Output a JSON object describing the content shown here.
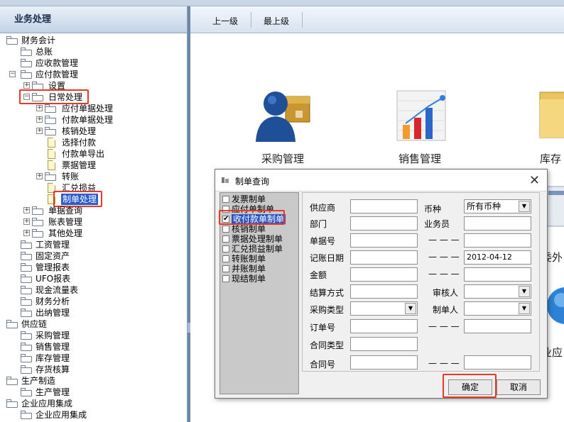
{
  "left_panel": {
    "title": "业务处理"
  },
  "tree": {
    "n0": "财务会计",
    "n1": "总账",
    "n2": "应收款管理",
    "n3": "应付款管理",
    "n4": "设置",
    "n5": "日常处理",
    "n6": "应付单据处理",
    "n7": "付款单据处理",
    "n8": "核销处理",
    "n9": "选择付款",
    "n10": "付款单导出",
    "n11": "票据管理",
    "n12": "转账",
    "n13": "汇兑损益",
    "n14": "制单处理",
    "n15": "单据查询",
    "n16": "账表管理",
    "n17": "其他处理",
    "n18": "工资管理",
    "n19": "固定资产",
    "n20": "管理报表",
    "n21": "UFO报表",
    "n22": "现金流量表",
    "n23": "财务分析",
    "n24": "出纳管理",
    "n25": "供应链",
    "n26": "采购管理",
    "n27": "销售管理",
    "n28": "库存管理",
    "n29": "存货核算",
    "n30": "生产制造",
    "n31": "生产管理",
    "n32": "企业应用集成",
    "n33": "企业应用集成"
  },
  "toolbar": {
    "up_level": "上一级",
    "top_level": "最上级"
  },
  "modules": {
    "purchase": "采购管理",
    "sales": "销售管理",
    "inventory": "库存",
    "outsource": "委外",
    "enterprise": "业应"
  },
  "dialog": {
    "title": "制单查询",
    "types": [
      "发票制单",
      "应付单制单",
      "收付款单制单",
      "核销制单",
      "票据处理制单",
      "汇兑损益制单",
      "转账制单",
      "并账制单",
      "现结制单"
    ],
    "checked_index": 2,
    "labels": {
      "supplier": "供应商",
      "currency": "币种",
      "department": "部门",
      "salesperson": "业务员",
      "doc_no": "单据号",
      "dash": "— — —",
      "post_date": "记账日期",
      "amount": "金额",
      "settle_method": "结算方式",
      "auditor": "审核人",
      "purchase_type": "采购类型",
      "maker": "制单人",
      "order_no": "订单号",
      "contract_type": "合同类型",
      "contract_no": "合同号"
    },
    "values": {
      "currency": "所有币种",
      "post_date_to": "2012-04-12"
    },
    "ok": "确定",
    "cancel": "取消"
  },
  "colors": {
    "highlight": "#e53a2a",
    "selection": "#2b56c2"
  }
}
